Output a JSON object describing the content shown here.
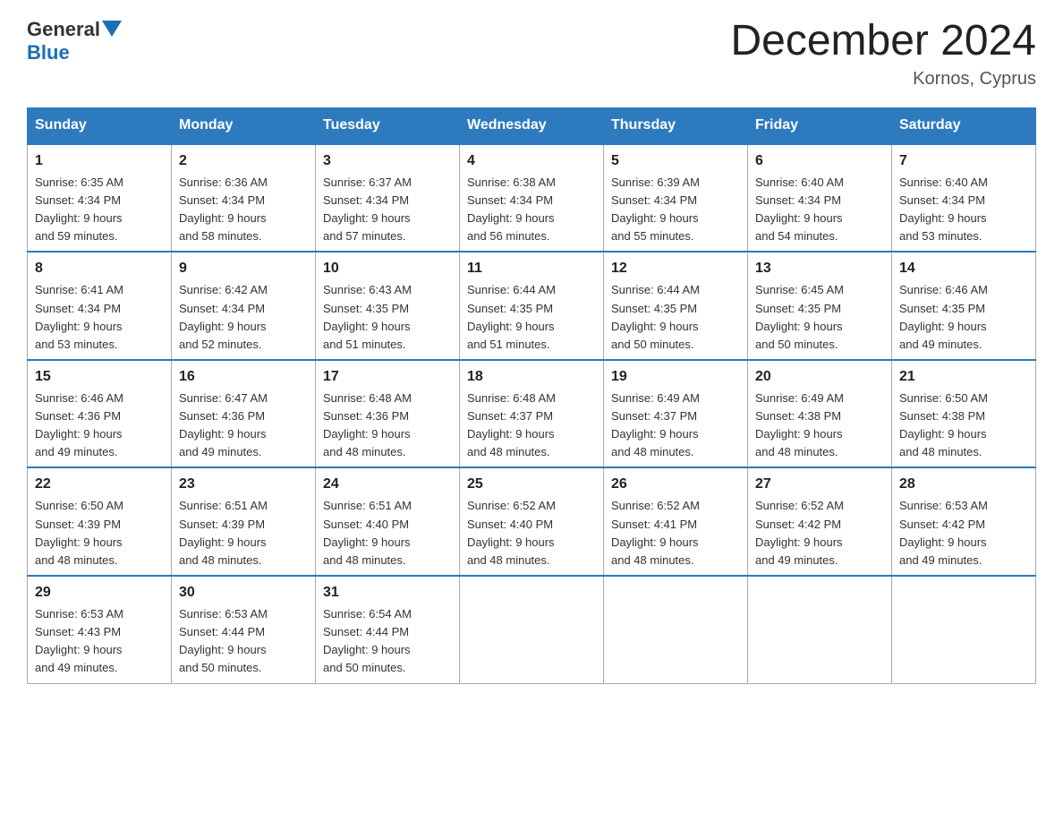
{
  "header": {
    "logo_general": "General",
    "logo_blue": "Blue",
    "month_title": "December 2024",
    "location": "Kornos, Cyprus"
  },
  "days_of_week": [
    "Sunday",
    "Monday",
    "Tuesday",
    "Wednesday",
    "Thursday",
    "Friday",
    "Saturday"
  ],
  "weeks": [
    [
      {
        "day": "1",
        "sunrise": "6:35 AM",
        "sunset": "4:34 PM",
        "daylight": "9 hours and 59 minutes."
      },
      {
        "day": "2",
        "sunrise": "6:36 AM",
        "sunset": "4:34 PM",
        "daylight": "9 hours and 58 minutes."
      },
      {
        "day": "3",
        "sunrise": "6:37 AM",
        "sunset": "4:34 PM",
        "daylight": "9 hours and 57 minutes."
      },
      {
        "day": "4",
        "sunrise": "6:38 AM",
        "sunset": "4:34 PM",
        "daylight": "9 hours and 56 minutes."
      },
      {
        "day": "5",
        "sunrise": "6:39 AM",
        "sunset": "4:34 PM",
        "daylight": "9 hours and 55 minutes."
      },
      {
        "day": "6",
        "sunrise": "6:40 AM",
        "sunset": "4:34 PM",
        "daylight": "9 hours and 54 minutes."
      },
      {
        "day": "7",
        "sunrise": "6:40 AM",
        "sunset": "4:34 PM",
        "daylight": "9 hours and 53 minutes."
      }
    ],
    [
      {
        "day": "8",
        "sunrise": "6:41 AM",
        "sunset": "4:34 PM",
        "daylight": "9 hours and 53 minutes."
      },
      {
        "day": "9",
        "sunrise": "6:42 AM",
        "sunset": "4:34 PM",
        "daylight": "9 hours and 52 minutes."
      },
      {
        "day": "10",
        "sunrise": "6:43 AM",
        "sunset": "4:35 PM",
        "daylight": "9 hours and 51 minutes."
      },
      {
        "day": "11",
        "sunrise": "6:44 AM",
        "sunset": "4:35 PM",
        "daylight": "9 hours and 51 minutes."
      },
      {
        "day": "12",
        "sunrise": "6:44 AM",
        "sunset": "4:35 PM",
        "daylight": "9 hours and 50 minutes."
      },
      {
        "day": "13",
        "sunrise": "6:45 AM",
        "sunset": "4:35 PM",
        "daylight": "9 hours and 50 minutes."
      },
      {
        "day": "14",
        "sunrise": "6:46 AM",
        "sunset": "4:35 PM",
        "daylight": "9 hours and 49 minutes."
      }
    ],
    [
      {
        "day": "15",
        "sunrise": "6:46 AM",
        "sunset": "4:36 PM",
        "daylight": "9 hours and 49 minutes."
      },
      {
        "day": "16",
        "sunrise": "6:47 AM",
        "sunset": "4:36 PM",
        "daylight": "9 hours and 49 minutes."
      },
      {
        "day": "17",
        "sunrise": "6:48 AM",
        "sunset": "4:36 PM",
        "daylight": "9 hours and 48 minutes."
      },
      {
        "day": "18",
        "sunrise": "6:48 AM",
        "sunset": "4:37 PM",
        "daylight": "9 hours and 48 minutes."
      },
      {
        "day": "19",
        "sunrise": "6:49 AM",
        "sunset": "4:37 PM",
        "daylight": "9 hours and 48 minutes."
      },
      {
        "day": "20",
        "sunrise": "6:49 AM",
        "sunset": "4:38 PM",
        "daylight": "9 hours and 48 minutes."
      },
      {
        "day": "21",
        "sunrise": "6:50 AM",
        "sunset": "4:38 PM",
        "daylight": "9 hours and 48 minutes."
      }
    ],
    [
      {
        "day": "22",
        "sunrise": "6:50 AM",
        "sunset": "4:39 PM",
        "daylight": "9 hours and 48 minutes."
      },
      {
        "day": "23",
        "sunrise": "6:51 AM",
        "sunset": "4:39 PM",
        "daylight": "9 hours and 48 minutes."
      },
      {
        "day": "24",
        "sunrise": "6:51 AM",
        "sunset": "4:40 PM",
        "daylight": "9 hours and 48 minutes."
      },
      {
        "day": "25",
        "sunrise": "6:52 AM",
        "sunset": "4:40 PM",
        "daylight": "9 hours and 48 minutes."
      },
      {
        "day": "26",
        "sunrise": "6:52 AM",
        "sunset": "4:41 PM",
        "daylight": "9 hours and 48 minutes."
      },
      {
        "day": "27",
        "sunrise": "6:52 AM",
        "sunset": "4:42 PM",
        "daylight": "9 hours and 49 minutes."
      },
      {
        "day": "28",
        "sunrise": "6:53 AM",
        "sunset": "4:42 PM",
        "daylight": "9 hours and 49 minutes."
      }
    ],
    [
      {
        "day": "29",
        "sunrise": "6:53 AM",
        "sunset": "4:43 PM",
        "daylight": "9 hours and 49 minutes."
      },
      {
        "day": "30",
        "sunrise": "6:53 AM",
        "sunset": "4:44 PM",
        "daylight": "9 hours and 50 minutes."
      },
      {
        "day": "31",
        "sunrise": "6:54 AM",
        "sunset": "4:44 PM",
        "daylight": "9 hours and 50 minutes."
      },
      null,
      null,
      null,
      null
    ]
  ],
  "labels": {
    "sunrise": "Sunrise:",
    "sunset": "Sunset:",
    "daylight": "Daylight:"
  }
}
